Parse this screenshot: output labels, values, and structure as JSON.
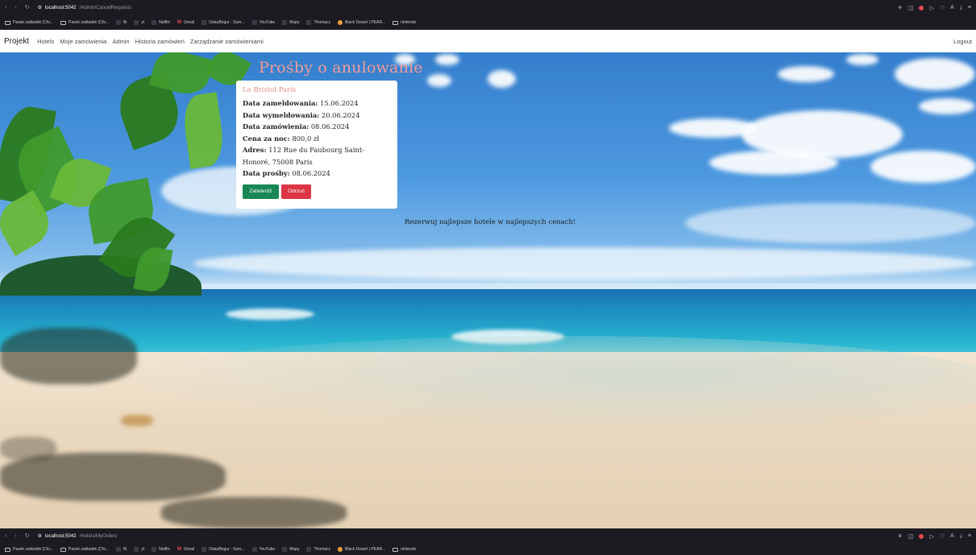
{
  "browser_top": {
    "url_host": "localhost:5042",
    "url_path": "/Admin/CancelRequests",
    "bookmarks": [
      "Pasek zakładek (Chr...",
      "Pasek zakładek (Chr...",
      "fb",
      "yt",
      "Netflix",
      "Gmail",
      "OdauBegur - Sum...",
      "YouTube",
      "Mapy",
      "Thomacz",
      "Black Desert | PEAR...",
      "nintendo"
    ]
  },
  "browser_bottom": {
    "url_host": "localhost:5042",
    "url_path": "/Hotels/MyOrders",
    "bookmarks": [
      "Pasek zakładek (Chr...",
      "Pasek zakładek (Chr...",
      "fb",
      "yt",
      "Netflix",
      "Gmail",
      "OdauBegur - Sum...",
      "YouTube",
      "Mapy",
      "Thomacz",
      "Black Desert | PEAR...",
      "nintendo"
    ]
  },
  "navbar": {
    "brand": "Projekt",
    "links": [
      "Hotels",
      "Moje zamówienia",
      "Admin",
      "Historia zamówień",
      "Zarządzanie zamówieniami"
    ],
    "logout": "Logout"
  },
  "page": {
    "heading": "Prośby o anulowanie",
    "tagline": "Rezerwuj najlepsze hotele w najlepszych cenach!"
  },
  "request": {
    "hotel": "Le Bristol Paris",
    "checkin_label": "Data zameldowania:",
    "checkin": "15.06.2024",
    "checkout_label": "Data wymeldowania:",
    "checkout": "20.06.2024",
    "order_label": "Data zamówienia:",
    "order": "08.06.2024",
    "price_label": "Cena za noc:",
    "price": "800,0 zł",
    "address_label": "Adres:",
    "address": "112 Rue du Faubourg Saint-Honoré, 75008 Paris",
    "request_label": "Data prośby:",
    "request_date": "08.06.2024",
    "approve": "Zatwierdź",
    "reject": "Odrzuć"
  },
  "colors": {
    "heading": "#f29a9a",
    "approve": "#198754",
    "reject": "#dc3545"
  }
}
